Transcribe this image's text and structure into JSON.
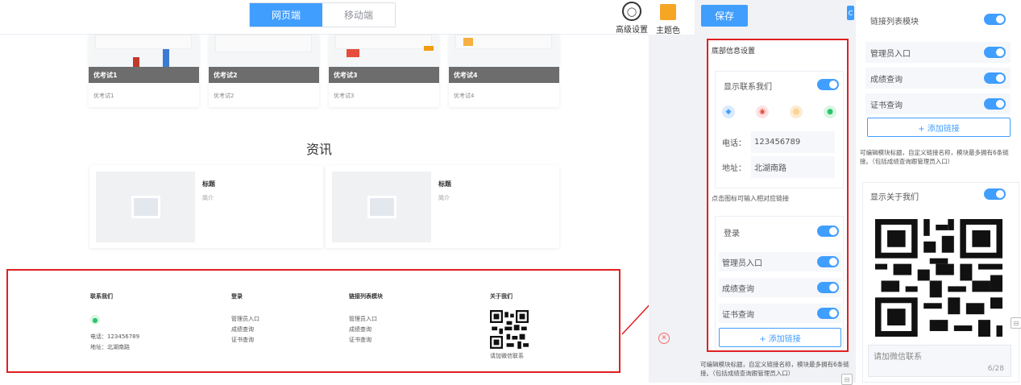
{
  "tabs": {
    "web": "网页端",
    "mobile": "移动端"
  },
  "toolbar": {
    "advanced": "高级设置",
    "theme": "主题色",
    "save": "保存",
    "theme_color": "#f5a623",
    "accent": "#409eff"
  },
  "products": [
    {
      "caption": "优考试1",
      "sub": "优考试1"
    },
    {
      "caption": "优考试2",
      "sub": "优考试2"
    },
    {
      "caption": "优考试3",
      "sub": "优考试3"
    },
    {
      "caption": "优考试4",
      "sub": "优考试4"
    }
  ],
  "news": {
    "section_title": "资讯",
    "items": [
      {
        "title": "标题",
        "brief": "简介"
      },
      {
        "title": "标题",
        "brief": "简介"
      }
    ]
  },
  "footer_preview": {
    "contact": {
      "heading": "联系我们",
      "phone": "电话：123456789",
      "address": "地址：北湖南路"
    },
    "login": {
      "heading": "登录",
      "links": [
        "管理员入口",
        "成绩查询",
        "证书查询"
      ]
    },
    "link_list": {
      "heading": "链接列表模块",
      "links": [
        "管理员入口",
        "成绩查询",
        "证书查询"
      ]
    },
    "about": {
      "heading": "关于我们",
      "qr_caption": "请加微信联系"
    }
  },
  "settings": {
    "title": "底部信息设置",
    "contact_toggle": "显示联系我们",
    "phone_label": "电话：",
    "phone_value": "123456789",
    "address_label": "地址：",
    "address_value": "北湖南路",
    "icon_hint": "点击图标可输入相对应链接",
    "login_toggle": "登录",
    "login_links": [
      "管理员入口",
      "成绩查询",
      "证书查询"
    ],
    "add_link": "+ 添加链接",
    "hint": "可编辑模块标题，自定义链接名称，模块最多拥有6条链接。（包括成绩查询跟管理员入口）"
  },
  "side": {
    "link_module_toggle": "链接列表模块",
    "links": [
      "管理员入口",
      "成绩查询",
      "证书查询"
    ],
    "add_link": "+ 添加链接",
    "hint": "可编辑模块标题，自定义链接名称，模块最多拥有6条链接。（包括成绩查询跟管理员入口）",
    "about_toggle": "显示关于我们",
    "wechat_placeholder": "请加微信联系",
    "counter": "6/28"
  }
}
